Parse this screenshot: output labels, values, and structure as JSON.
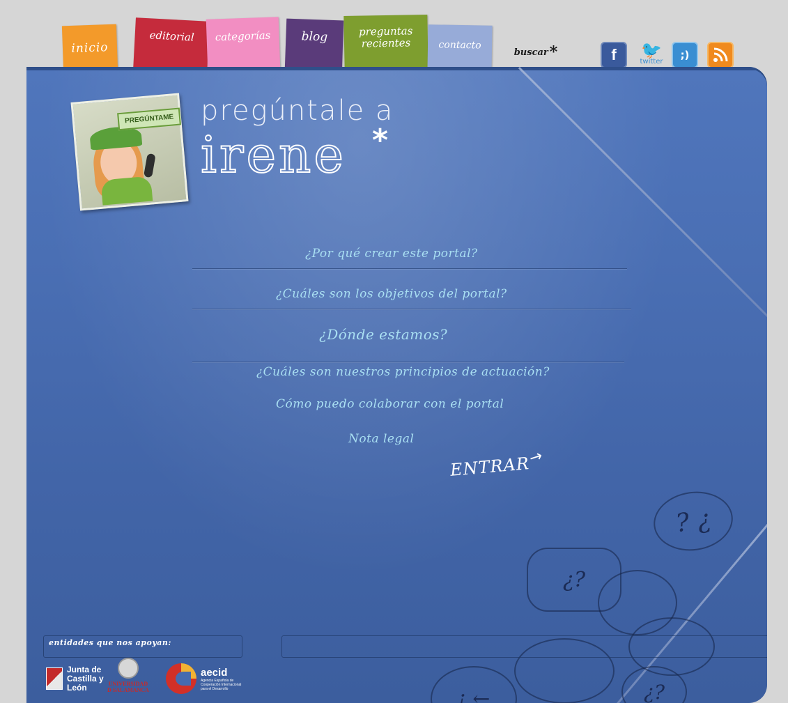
{
  "nav": {
    "tabs": [
      {
        "label": "inicio"
      },
      {
        "label": "editorial"
      },
      {
        "label": "categorías"
      },
      {
        "label": "blog"
      },
      {
        "label": "preguntas recientes",
        "line1": "preguntas",
        "line2": "recientes"
      },
      {
        "label": "contacto"
      }
    ],
    "search_label": "buscar",
    "search_mark": "*"
  },
  "social": {
    "facebook": "f",
    "twitter": "twitter",
    "smiley": ";)",
    "rss": "RSS"
  },
  "colors": {
    "inicio": "#f39a2a",
    "editorial": "#c52b3c",
    "categorias": "#f28ec2",
    "blog": "#5a3b7a",
    "preguntas": "#7e9e2f",
    "contacto": "#97abd8",
    "folder": "#4a6fb4"
  },
  "hero": {
    "sign": "PREGÚNTAME",
    "logo_line1": "pregúntale a",
    "logo_line2": "irene",
    "logo_mark": "*"
  },
  "menu": [
    "¿Por qué crear este portal?",
    "¿Cuáles son los objetivos del portal?",
    "¿Dónde estamos?",
    "¿Cuáles son nuestros principios de actuación?",
    "Cómo puedo colaborar con el portal",
    "Nota legal"
  ],
  "enter_label": "ENTRAR",
  "doodles": {
    "bubble1": "? ¿",
    "bubble2": "¿?",
    "bubble5": "¡ ←",
    "bubble6": "¿?"
  },
  "footer": {
    "label": "entidades que nos apoyan:",
    "sponsors": {
      "jcyl": "Junta de Castilla y León",
      "usal_line1": "UNIVERSIDAD",
      "usal_line2": "D SALAMANCA",
      "aecid_name": "aecid",
      "aecid_sub": "Agencia Española de Cooperación Internacional para el Desarrollo"
    }
  }
}
